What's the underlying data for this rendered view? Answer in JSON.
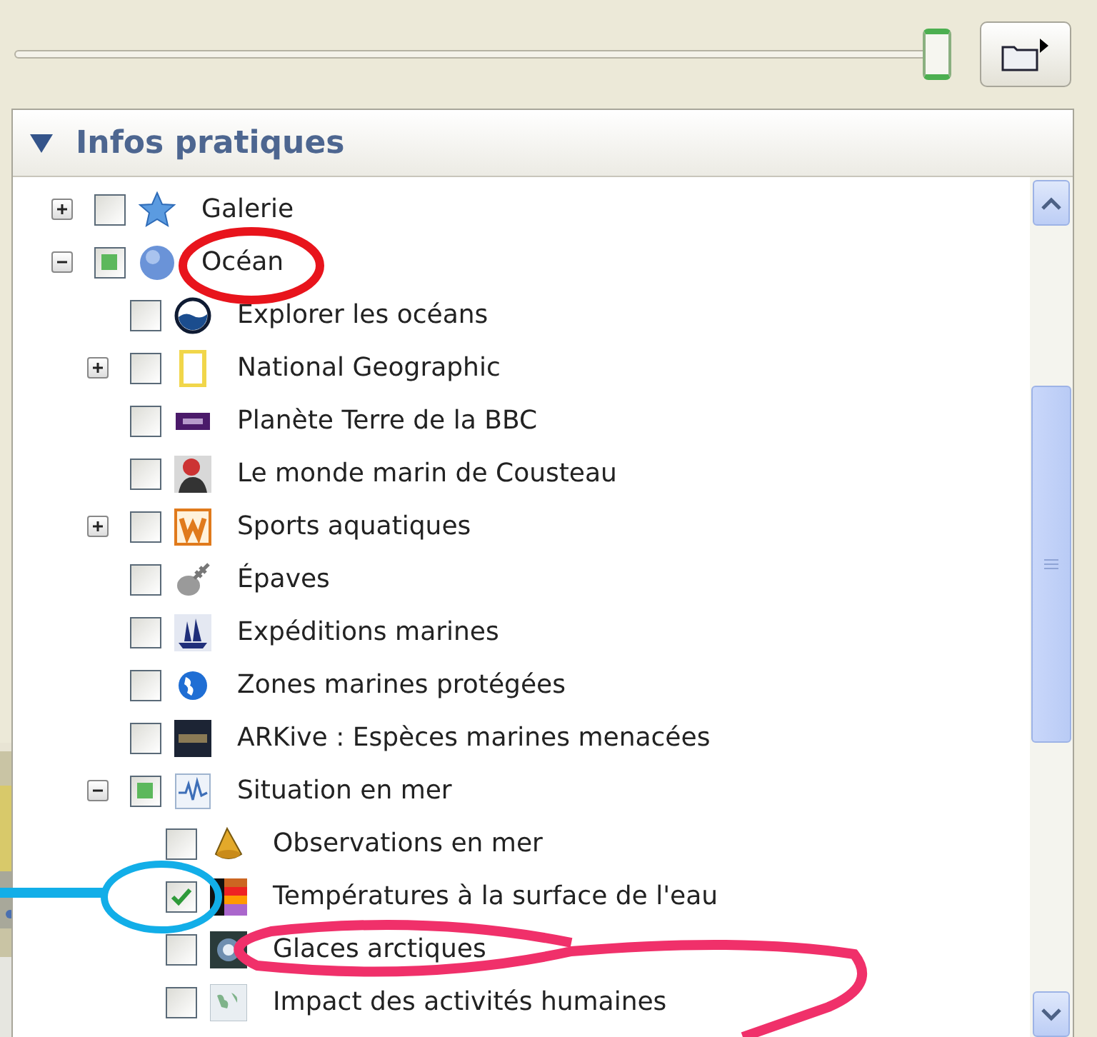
{
  "opacity_slider": {
    "level": 1
  },
  "panel": {
    "title": "Infos pratiques",
    "expanded": true
  },
  "tree": [
    {
      "label": "Galerie",
      "expanded": false,
      "checked": false,
      "partial": false
    },
    {
      "label": "Océan",
      "expanded": true,
      "checked": false,
      "partial": true,
      "children": [
        {
          "label": "Explorer les océans",
          "checked": false,
          "partial": false
        },
        {
          "label": "National Geographic",
          "expanded": false,
          "checked": false,
          "partial": false
        },
        {
          "label": "Planète Terre de la BBC",
          "checked": false,
          "partial": false
        },
        {
          "label": "Le monde marin de Cousteau",
          "checked": false,
          "partial": false
        },
        {
          "label": "Sports aquatiques",
          "expanded": false,
          "checked": false,
          "partial": false
        },
        {
          "label": "Épaves",
          "checked": false,
          "partial": false
        },
        {
          "label": "Expéditions marines",
          "checked": false,
          "partial": false
        },
        {
          "label": "Zones marines protégées",
          "checked": false,
          "partial": false
        },
        {
          "label": "ARKive : Espèces marines menacées",
          "checked": false,
          "partial": false
        },
        {
          "label": "Situation en mer",
          "expanded": true,
          "checked": false,
          "partial": true,
          "children": [
            {
              "label": "Observations en mer",
              "checked": false,
              "partial": false
            },
            {
              "label": "Températures à la surface de l'eau",
              "checked": true,
              "partial": false
            },
            {
              "label": "Glaces arctiques",
              "checked": false,
              "partial": false
            },
            {
              "label": "Impact des activités humaines",
              "checked": false,
              "partial": false
            }
          ]
        }
      ]
    }
  ]
}
